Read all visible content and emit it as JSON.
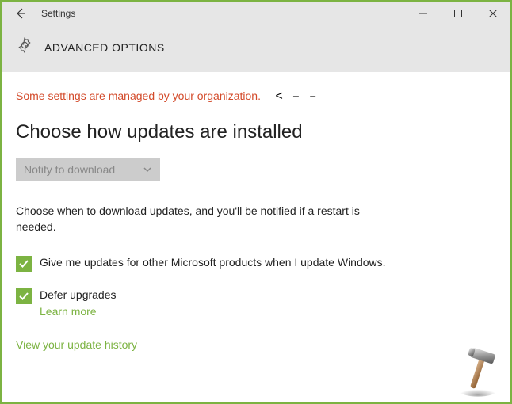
{
  "titlebar": {
    "title": "Settings"
  },
  "header": {
    "title": "ADVANCED OPTIONS"
  },
  "content": {
    "org_warning": "Some settings are managed by your organization.",
    "arrow_note": "< – –",
    "section_heading": "Choose how updates are installed",
    "dropdown_value": "Notify to download",
    "description": "Choose when to download updates, and you'll be notified if a restart is needed.",
    "checkbox1_label": "Give me updates for other Microsoft products when I update Windows.",
    "checkbox2_label": "Defer upgrades",
    "learn_more": "Learn more",
    "history_link": "View your update history"
  }
}
